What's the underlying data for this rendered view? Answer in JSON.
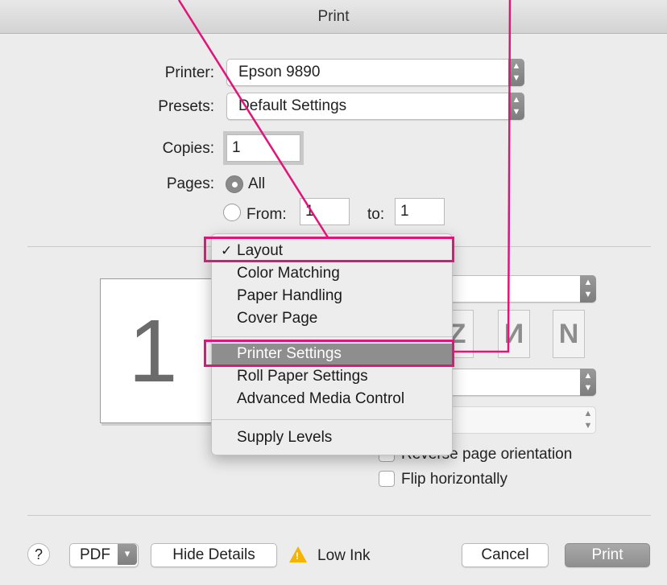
{
  "window": {
    "title": "Print"
  },
  "printer": {
    "label": "Printer:",
    "value": "Epson 9890"
  },
  "presets": {
    "label": "Presets:",
    "value": "Default Settings"
  },
  "copies": {
    "label": "Copies:",
    "value": "1"
  },
  "pages": {
    "label": "Pages:",
    "all_label": "All",
    "from_label": "From:",
    "from_value": "1",
    "to_label": "to:",
    "to_value": "1",
    "selected": "All"
  },
  "preview": {
    "page_number": "1"
  },
  "menu": {
    "items": [
      {
        "label": "Layout",
        "checked": true
      },
      {
        "label": "Color Matching"
      },
      {
        "label": "Paper Handling"
      },
      {
        "label": "Cover Page"
      },
      {
        "label": "Printer Settings",
        "highlighted": true
      },
      {
        "label": "Roll Paper Settings"
      },
      {
        "label": "Advanced Media Control"
      },
      {
        "label": "Supply Levels"
      }
    ]
  },
  "layout_options": {
    "reverse_label": "Reverse page orientation",
    "flip_label": "Flip horizontally"
  },
  "footer": {
    "help_label": "?",
    "pdf_label": "PDF",
    "hide_details_label": "Hide Details",
    "low_ink_label": "Low Ink",
    "cancel_label": "Cancel",
    "print_label": "Print"
  },
  "colors": {
    "callout": "#e0157a",
    "highlight": "#8e8e8e"
  }
}
